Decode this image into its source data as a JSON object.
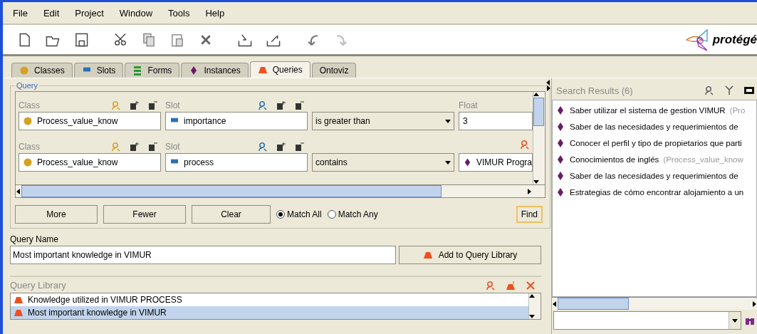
{
  "menu": [
    "File",
    "Edit",
    "Project",
    "Window",
    "Tools",
    "Help"
  ],
  "logo": "protégé",
  "tabs": [
    {
      "label": "Classes",
      "kind": "class",
      "selected": false
    },
    {
      "label": "Slots",
      "kind": "slot",
      "selected": false
    },
    {
      "label": "Forms",
      "kind": "form",
      "selected": false
    },
    {
      "label": "Instances",
      "kind": "instance",
      "selected": false
    },
    {
      "label": "Queries",
      "kind": "query",
      "selected": true
    },
    {
      "label": "Ontoviz",
      "kind": "plain",
      "selected": false
    }
  ],
  "query": {
    "title": "Query",
    "rows": [
      {
        "class_label": "Class",
        "class": "Process_value_know",
        "slot_label": "Slot",
        "slot": "importance",
        "operator": "is greater than",
        "value_label": "Float",
        "value": "3",
        "kind": "text"
      },
      {
        "class_label": "Class",
        "class": "Process_value_know",
        "slot_label": "Slot",
        "slot": "process",
        "operator": "contains",
        "value": "VIMUR Progra",
        "kind": "instance"
      }
    ],
    "buttons": [
      "More",
      "Fewer",
      "Clear"
    ],
    "match": [
      {
        "label": "Match All",
        "selected": true
      },
      {
        "label": "Match Any",
        "selected": false
      }
    ],
    "find": "Find"
  },
  "query_name": {
    "label": "Query Name",
    "value": "Most important knowledge in VIMUR",
    "add_button": "Add to Query Library"
  },
  "library": {
    "title": "Query Library",
    "items": [
      {
        "label": "Knowledge utilized in VIMUR PROCESS",
        "selected": false
      },
      {
        "label": "Most important knowledge in VIMUR",
        "selected": true
      }
    ]
  },
  "results": {
    "title": "Search Results (6)",
    "items": [
      {
        "text": "Saber utilizar el sistema de gestion VIMUR",
        "note": "(Pro"
      },
      {
        "text": "Saber de las necesidades y requerimientos de"
      },
      {
        "text": "Conocer el perfil y tipo de propietarios que parti"
      },
      {
        "text": "Conocimientos de inglés",
        "note": "(Process_value_know"
      },
      {
        "text": "Saber de las necesidades y requerimientos de"
      },
      {
        "text": "Estrategias de cómo encontrar alojamiento a un"
      }
    ]
  }
}
